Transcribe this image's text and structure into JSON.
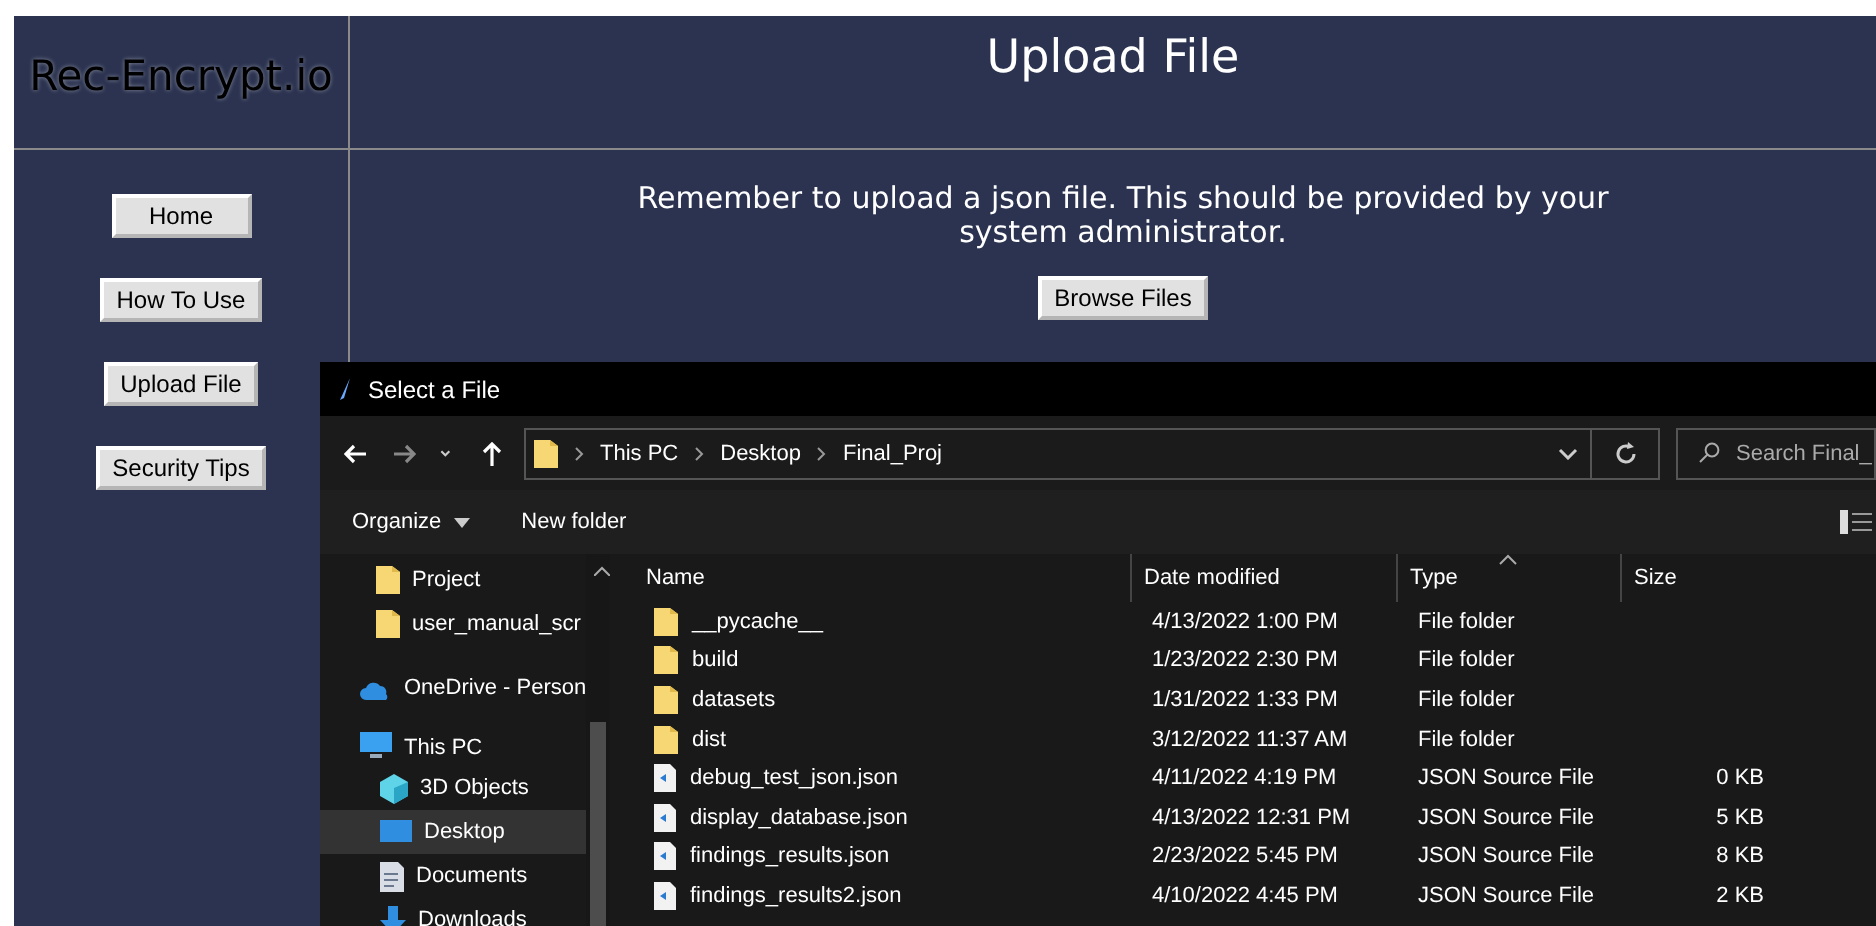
{
  "app": {
    "logo": "Rec-Encrypt.io",
    "title": "Upload File",
    "nav_buttons": [
      {
        "label": "Home"
      },
      {
        "label": "How To Use"
      },
      {
        "label": "Upload File"
      },
      {
        "label": "Security Tips"
      }
    ],
    "message": "Remember to upload a json file. This should be provided by your system administrator.",
    "browse_button": "Browse Files"
  },
  "dialog": {
    "title": "Select a File",
    "breadcrumb": [
      "This PC",
      "Desktop",
      "Final_Proj"
    ],
    "search": {
      "placeholder": "Search Final_"
    },
    "toolbar": {
      "organize": "Organize",
      "new_folder": "New folder"
    },
    "nav_items": [
      {
        "label": "Project",
        "kind": "folder",
        "selected": false
      },
      {
        "label": "user_manual_scr",
        "kind": "folder",
        "selected": false
      },
      {
        "label": "OneDrive - Person",
        "kind": "cloud",
        "selected": false
      },
      {
        "label": "This PC",
        "kind": "pc",
        "selected": false,
        "children": [
          {
            "label": "3D Objects",
            "kind": "cube",
            "selected": false
          },
          {
            "label": "Desktop",
            "kind": "desktop",
            "selected": true
          },
          {
            "label": "Documents",
            "kind": "document",
            "selected": false
          },
          {
            "label": "Downloads",
            "kind": "download",
            "selected": false
          }
        ]
      }
    ],
    "columns": [
      "Name",
      "Date modified",
      "Type",
      "Size"
    ],
    "files": [
      {
        "name": "__pycache__",
        "kind": "folder",
        "date": "4/13/2022 1:00 PM",
        "type": "File folder"
      },
      {
        "name": "build",
        "kind": "folder",
        "date": "1/23/2022 2:30 PM",
        "type": "File folder"
      },
      {
        "name": "datasets",
        "kind": "folder",
        "date": "1/31/2022 1:33 PM",
        "type": "File folder"
      },
      {
        "name": "dist",
        "kind": "folder",
        "date": "3/12/2022 11:37 AM",
        "type": "File folder"
      },
      {
        "name": "debug_test_json.json",
        "kind": "json",
        "date": "4/11/2022 4:19 PM",
        "type": "JSON Source File",
        "size": "0 KB"
      },
      {
        "name": "display_database.json",
        "kind": "json",
        "date": "4/13/2022 12:31 PM",
        "type": "JSON Source File",
        "size": "5 KB"
      },
      {
        "name": "findings_results.json",
        "kind": "json",
        "date": "2/23/2022 5:45 PM",
        "type": "JSON Source File",
        "size": "8 KB"
      },
      {
        "name": "findings_results2.json",
        "kind": "json",
        "date": "4/10/2022 4:45 PM",
        "type": "JSON Source File",
        "size": "2 KB"
      }
    ]
  }
}
